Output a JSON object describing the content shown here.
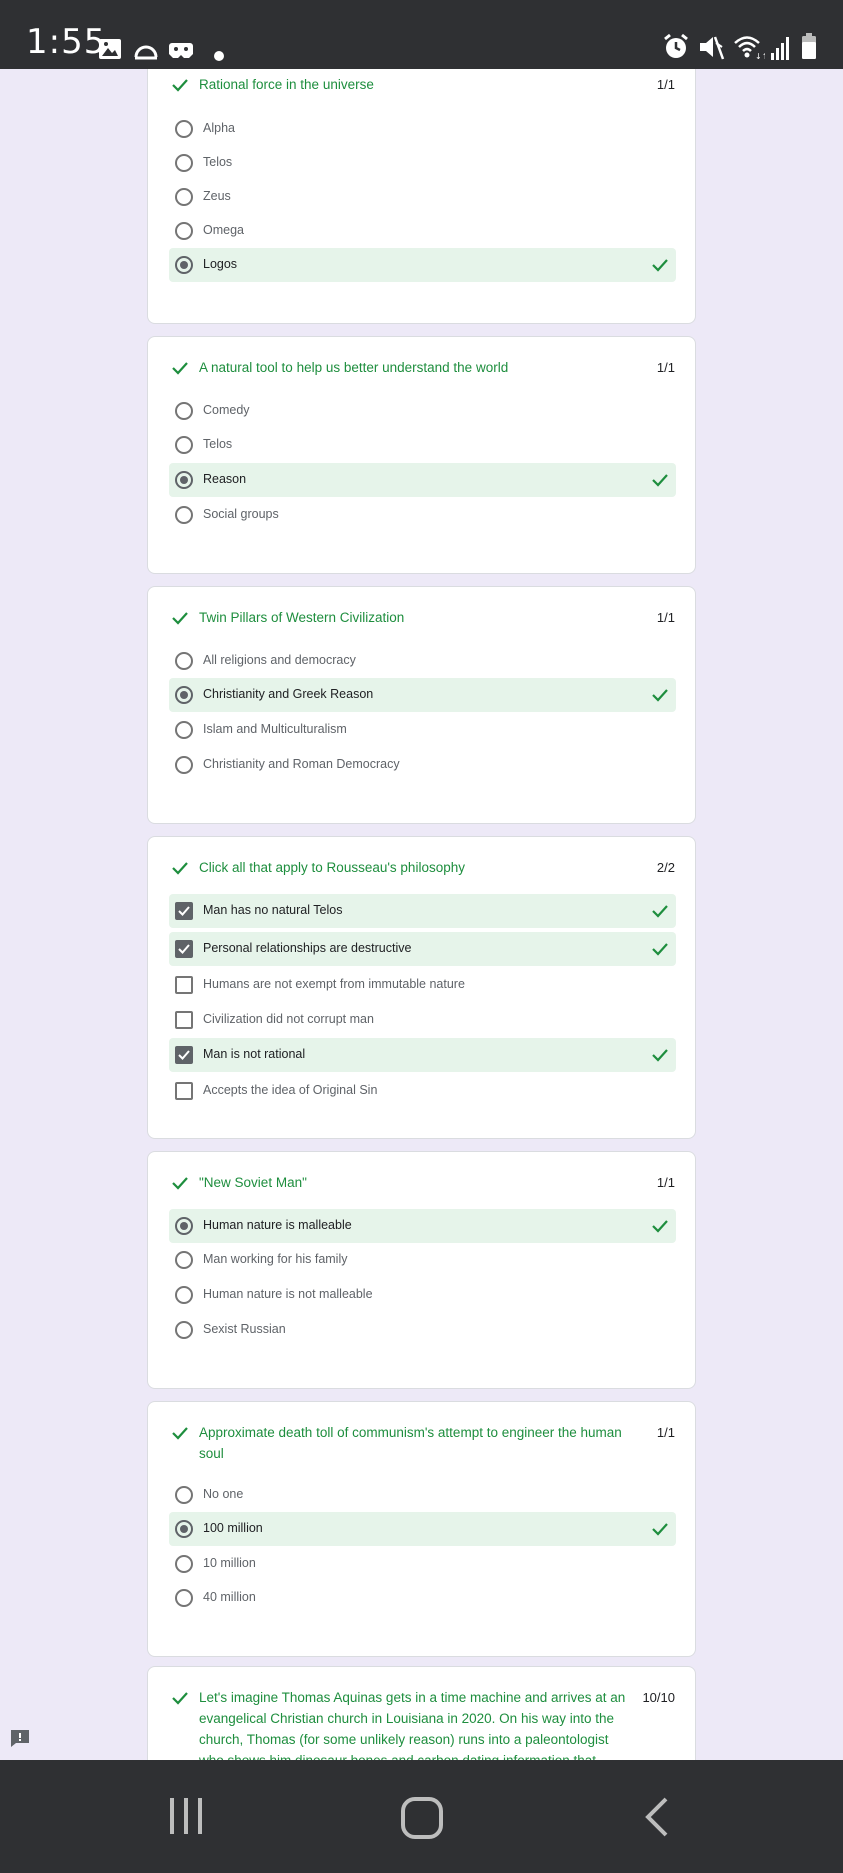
{
  "status_bar": {
    "time": "1:55",
    "icons": [
      "image-icon",
      "half-circle-icon",
      "game-controller-icon",
      "dot-icon",
      "alarm-icon",
      "mute-icon",
      "wifi-icon",
      "signal-icon",
      "battery-icon"
    ]
  },
  "colors": {
    "accent_green": "#1e8e3e",
    "correct_bg": "#e6f4ea",
    "page_bg": "#ede9f7",
    "bars": "#2f3033"
  },
  "questions": [
    {
      "title": "Rational force in the universe",
      "score": "1/1",
      "type": "radio",
      "options": [
        {
          "label": "Alpha",
          "selected": false,
          "correct": false
        },
        {
          "label": "Telos",
          "selected": false,
          "correct": false
        },
        {
          "label": "Zeus",
          "selected": false,
          "correct": false
        },
        {
          "label": "Omega",
          "selected": false,
          "correct": false
        },
        {
          "label": "Logos",
          "selected": true,
          "correct": true
        }
      ]
    },
    {
      "title": "A natural tool to help us better understand the world",
      "score": "1/1",
      "type": "radio",
      "options": [
        {
          "label": "Comedy",
          "selected": false,
          "correct": false
        },
        {
          "label": "Telos",
          "selected": false,
          "correct": false
        },
        {
          "label": "Reason",
          "selected": true,
          "correct": true
        },
        {
          "label": "Social groups",
          "selected": false,
          "correct": false
        }
      ]
    },
    {
      "title": "Twin Pillars of Western Civilization",
      "score": "1/1",
      "type": "radio",
      "options": [
        {
          "label": "All religions and democracy",
          "selected": false,
          "correct": false
        },
        {
          "label": "Christianity and Greek Reason",
          "selected": true,
          "correct": true
        },
        {
          "label": "Islam and Multiculturalism",
          "selected": false,
          "correct": false
        },
        {
          "label": "Christianity and Roman Democracy",
          "selected": false,
          "correct": false
        }
      ]
    },
    {
      "title": "Click all that apply to Rousseau's philosophy",
      "score": "2/2",
      "type": "checkbox",
      "options": [
        {
          "label": "Man has no natural Telos",
          "selected": true,
          "correct": true
        },
        {
          "label": "Personal relationships are destructive",
          "selected": true,
          "correct": true
        },
        {
          "label": "Humans are not exempt from immutable nature",
          "selected": false,
          "correct": false
        },
        {
          "label": "Civilization did not corrupt man",
          "selected": false,
          "correct": false
        },
        {
          "label": "Man is not rational",
          "selected": true,
          "correct": true
        },
        {
          "label": "Accepts the idea of Original Sin",
          "selected": false,
          "correct": false
        }
      ]
    },
    {
      "title": "\"New Soviet Man\"",
      "score": "1/1",
      "type": "radio",
      "options": [
        {
          "label": "Human nature is malleable",
          "selected": true,
          "correct": true
        },
        {
          "label": "Man working for his family",
          "selected": false,
          "correct": false
        },
        {
          "label": "Human nature is not malleable",
          "selected": false,
          "correct": false
        },
        {
          "label": "Sexist Russian",
          "selected": false,
          "correct": false
        }
      ]
    },
    {
      "title": "Approximate death toll of communism's attempt to engineer the human soul",
      "score": "1/1",
      "type": "radio",
      "options": [
        {
          "label": "No one",
          "selected": false,
          "correct": false
        },
        {
          "label": "100 million",
          "selected": true,
          "correct": true
        },
        {
          "label": "10 million",
          "selected": false,
          "correct": false
        },
        {
          "label": "40 million",
          "selected": false,
          "correct": false
        }
      ]
    },
    {
      "title": "Let's imagine Thomas Aquinas gets in a time machine and arrives at an evangelical Christian church in Louisiana in 2020. On his way into the church, Thomas (for some unlikely reason) runs into a paleontologist who shows him dinosaur bones and carbon dating information that",
      "score": "10/10",
      "type": "text",
      "options": []
    }
  ]
}
